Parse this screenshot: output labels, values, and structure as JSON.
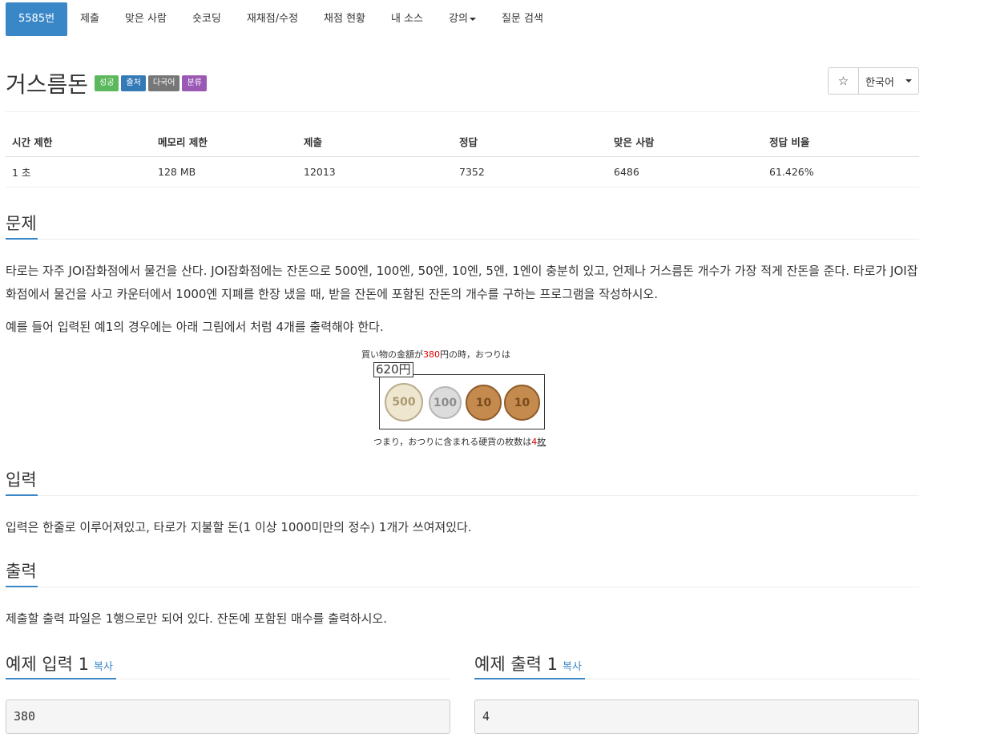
{
  "nav": {
    "items": [
      {
        "label": "5585번"
      },
      {
        "label": "제출"
      },
      {
        "label": "맞은 사람"
      },
      {
        "label": "숏코딩"
      },
      {
        "label": "재채점/수정"
      },
      {
        "label": "채점 현황"
      },
      {
        "label": "내 소스"
      },
      {
        "label": "강의"
      },
      {
        "label": "질문 검색"
      }
    ]
  },
  "problem": {
    "title": "거스름돈",
    "badges": [
      {
        "label": "성공",
        "color": "#5cb85c"
      },
      {
        "label": "출처",
        "color": "#337ab7"
      },
      {
        "label": "다국어",
        "color": "#777777"
      },
      {
        "label": "분류",
        "color": "#9b59b6"
      }
    ],
    "star": "☆",
    "language": "한국어"
  },
  "info": {
    "headers": [
      "시간 제한",
      "메모리 제한",
      "제출",
      "정답",
      "맞은 사람",
      "정답 비율"
    ],
    "values": [
      "1 초",
      "128 MB",
      "12013",
      "7352",
      "6486",
      "61.426%"
    ]
  },
  "sections": {
    "problem_title": "문제",
    "problem_text_1": "타로는 자주 JOI잡화점에서 물건을 산다. JOI잡화점에는 잔돈으로 500엔, 100엔, 50엔, 10엔, 5엔, 1엔이 충분히 있고, 언제나 거스름돈 개수가 가장 적게 잔돈을 준다. 타로가 JOI잡화점에서 물건을 사고 카운터에서 1000엔 지폐를 한장 냈을 때, 받을 잔돈에 포함된 잔돈의 개수를 구하는 프로그램을 작성하시오.",
    "problem_text_2": "예를 들어 입력된 예1의 경우에는 아래 그림에서 처럼 4개를 출력해야 한다.",
    "input_title": "입력",
    "input_text": "입력은 한줄로 이루어져있고, 타로가 지불할 돈(1 이상 1000미만의 정수) 1개가 쓰여져있다.",
    "output_title": "출력",
    "output_text": "제출할 출력 파일은 1행으로만 되어 있다. 잔돈에 포함된 매수를 출력하시오."
  },
  "figure": {
    "top_prefix": "買い物の金額が",
    "top_amount": "380",
    "top_suffix": "円の時，おつりは",
    "change_label": "620円",
    "coins": [
      "500",
      "100",
      "10",
      "10"
    ],
    "bottom_prefix": "つまり，おつりに含まれる硬貨の枚数は",
    "bottom_count": "4",
    "bottom_suffix": "枚"
  },
  "samples": {
    "input_title": "예제 입력 1",
    "output_title": "예제 출력 1",
    "copy_label": "복사",
    "input_value": "380",
    "output_value": "4"
  },
  "colors": {
    "accent": "#3a87c8",
    "coin_500": "#efe6cf",
    "coin_100": "#d9d9d9",
    "coin_10": "#c58b4e"
  }
}
